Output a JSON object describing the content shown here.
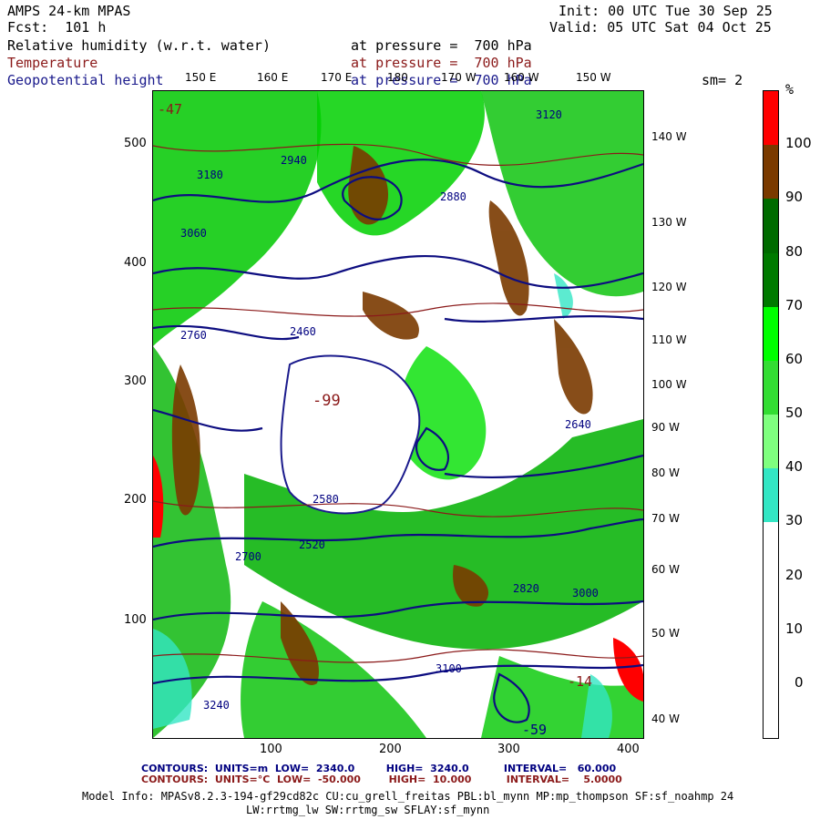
{
  "header": {
    "model": "AMPS 24-km MPAS",
    "fcst": "Fcst:  101 h",
    "init": "Init: 00 UTC Tue 30 Sep 25",
    "valid": "Valid: 05 UTC Sat 04 Oct 25",
    "sm": "sm= 2"
  },
  "fields": [
    {
      "name": "Relative humidity (w.r.t. water)",
      "pressure": "at pressure =  700 hPa",
      "color": "#000000"
    },
    {
      "name": "Temperature",
      "pressure": "at pressure =  700 hPa",
      "color": "#8b1a1a"
    },
    {
      "name": "Geopotential height",
      "pressure": "at pressure =  700 hPa",
      "color": "#1a1a8c"
    }
  ],
  "top_lon_labels": [
    "150 E",
    "160 E",
    "170 E",
    "180",
    "170 W",
    "160 W",
    "150 W"
  ],
  "right_lon_labels": [
    "140 W",
    "130 W",
    "120 W",
    "110 W",
    "100 W",
    "90 W",
    "80 W",
    "70 W",
    "60 W",
    "50 W",
    "40 W"
  ],
  "x_ticks": [
    "100",
    "200",
    "300",
    "400"
  ],
  "y_ticks": [
    "500",
    "400",
    "300",
    "200",
    "100"
  ],
  "colorbar": {
    "unit": "%",
    "labels": [
      "100",
      "90",
      "80",
      "70",
      "60",
      "50",
      "40",
      "30",
      "20",
      "10",
      "0"
    ],
    "colors": [
      "#ff0000",
      "#7a3a00",
      "#006b00",
      "#007a00",
      "#00ff00",
      "#33dd33",
      "#7fff7f",
      "#33e6c4",
      "#ffffff",
      "#ffffff",
      "#ffffff",
      "#ffffff"
    ]
  },
  "map_labels": {
    "heights": [
      "3120",
      "2940",
      "3180",
      "2880",
      "2760",
      "3060",
      "2640",
      "2580",
      "2700",
      "3000",
      "3100",
      "2820",
      "2520",
      "2460",
      "3240"
    ],
    "temps": [
      "-99",
      "-14",
      "-47",
      "-59"
    ]
  },
  "footer": {
    "line1": "CONTOURS:  UNITS=m  LOW=  2340.0         HIGH=  3240.0          INTERVAL=   60.000",
    "line2": "CONTOURS:  UNITS=°C  LOW=  -50.000        HIGH=  10.000          INTERVAL=    5.0000",
    "model_info": "Model Info: MPASv8.2.3-194-gf29cd82c CU:cu_grell_freitas PBL:bl_mynn MP:mp_thompson SF:sf_noahmp 24",
    "model_info2": "LW:rrtmg_lw SW:rrtmg_sw SFLAY:sf_mynn"
  }
}
